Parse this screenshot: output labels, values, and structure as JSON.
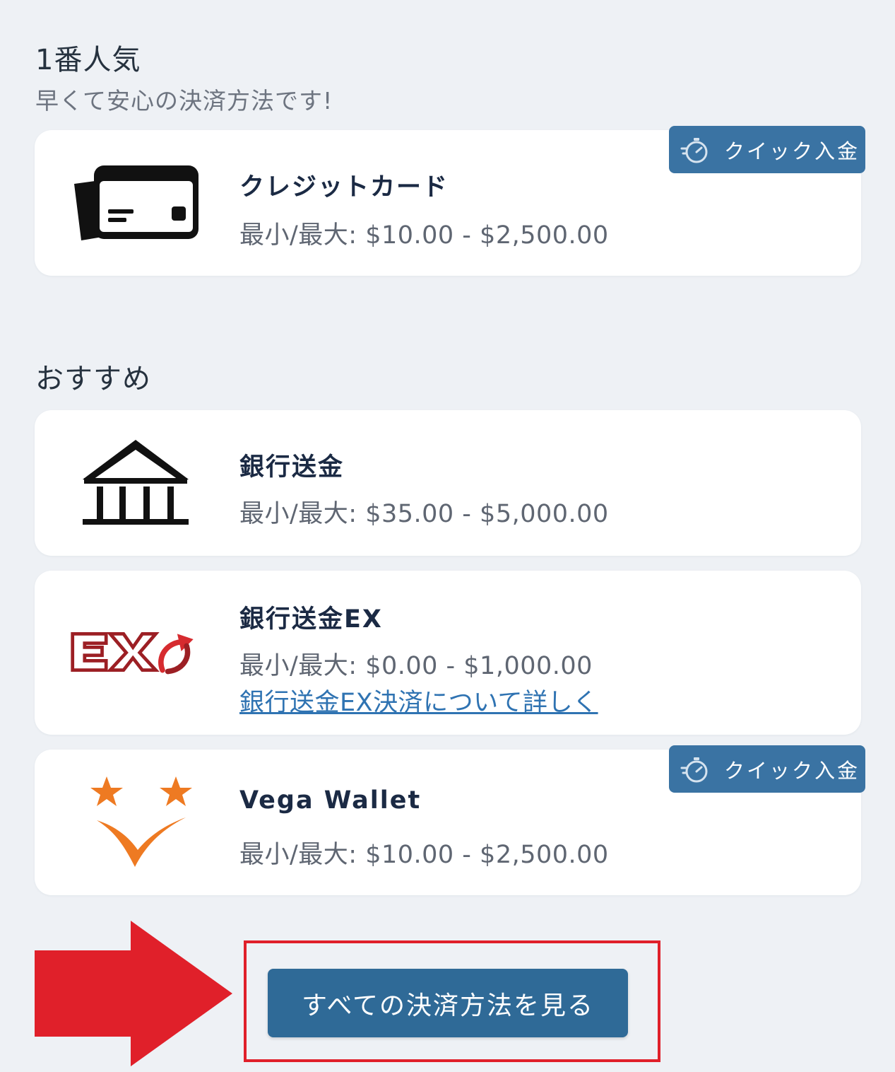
{
  "popular": {
    "title": "1番人気",
    "subtitle": "早くて安心の決済方法です!"
  },
  "recommended": {
    "title": "おすすめ"
  },
  "quick_deposit_label": "クイック入金",
  "methods": [
    {
      "name": "クレジットカード",
      "limits": "最小/最大: $10.00 - $2,500.00",
      "icon": "credit-card-icon",
      "quick_deposit": true
    },
    {
      "name": "銀行送金",
      "limits": "最小/最大: $35.00 - $5,000.00",
      "icon": "bank-icon",
      "quick_deposit": false
    },
    {
      "name": "銀行送金EX",
      "limits": "最小/最大: $0.00 - $1,000.00",
      "link": "銀行送金EX決済について詳しく",
      "icon": "bank-transfer-ex-logo",
      "quick_deposit": false
    },
    {
      "name": "Vega Wallet",
      "limits": "最小/最大: $10.00 - $2,500.00",
      "icon": "vega-wallet-logo",
      "quick_deposit": true
    }
  ],
  "cta": {
    "label": "すべての決済方法を見る"
  },
  "colors": {
    "background": "#eef1f5",
    "card": "#ffffff",
    "badge": "#3a73a3",
    "button": "#2f6a97",
    "link": "#2f73b2",
    "highlight": "#e0202a",
    "ex_logo": "#9c1f24",
    "vega_orange": "#ee7a22"
  }
}
